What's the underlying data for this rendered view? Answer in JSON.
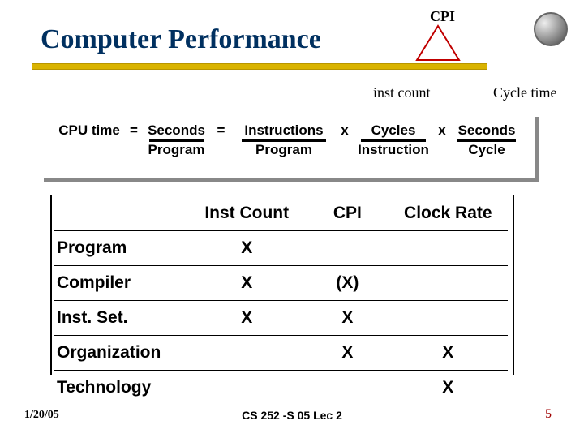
{
  "title": "Computer Performance",
  "top_label_cpi": "CPI",
  "annot_inst_count": "inst count",
  "annot_cycle_time": "Cycle time",
  "equation": {
    "lhs": "CPU time",
    "eq1": "=",
    "t1_num": "Seconds",
    "t1_den": "Program",
    "eq2": "=",
    "t2_num": "Instructions",
    "t2_den": "Program",
    "x1": "x",
    "t3_num": "Cycles",
    "t3_den": "Instruction",
    "x2": "x",
    "t4_num": "Seconds",
    "t4_den": "Cycle"
  },
  "table": {
    "headers": [
      "",
      "Inst Count",
      "CPI",
      "Clock Rate"
    ],
    "rows": [
      {
        "label": "Program",
        "c1": "X",
        "c2": "",
        "c3": ""
      },
      {
        "label": "Compiler",
        "c1": "X",
        "c2": "(X)",
        "c3": ""
      },
      {
        "label": "Inst. Set.",
        "c1": "X",
        "c2": "X",
        "c3": ""
      },
      {
        "label": "Organization",
        "c1": "",
        "c2": "X",
        "c3": "X"
      },
      {
        "label": "Technology",
        "c1": "",
        "c2": "",
        "c3": "X"
      }
    ]
  },
  "footer": {
    "date": "1/20/05",
    "center": "CS 252 -S 05 Lec 2",
    "page": "5"
  }
}
